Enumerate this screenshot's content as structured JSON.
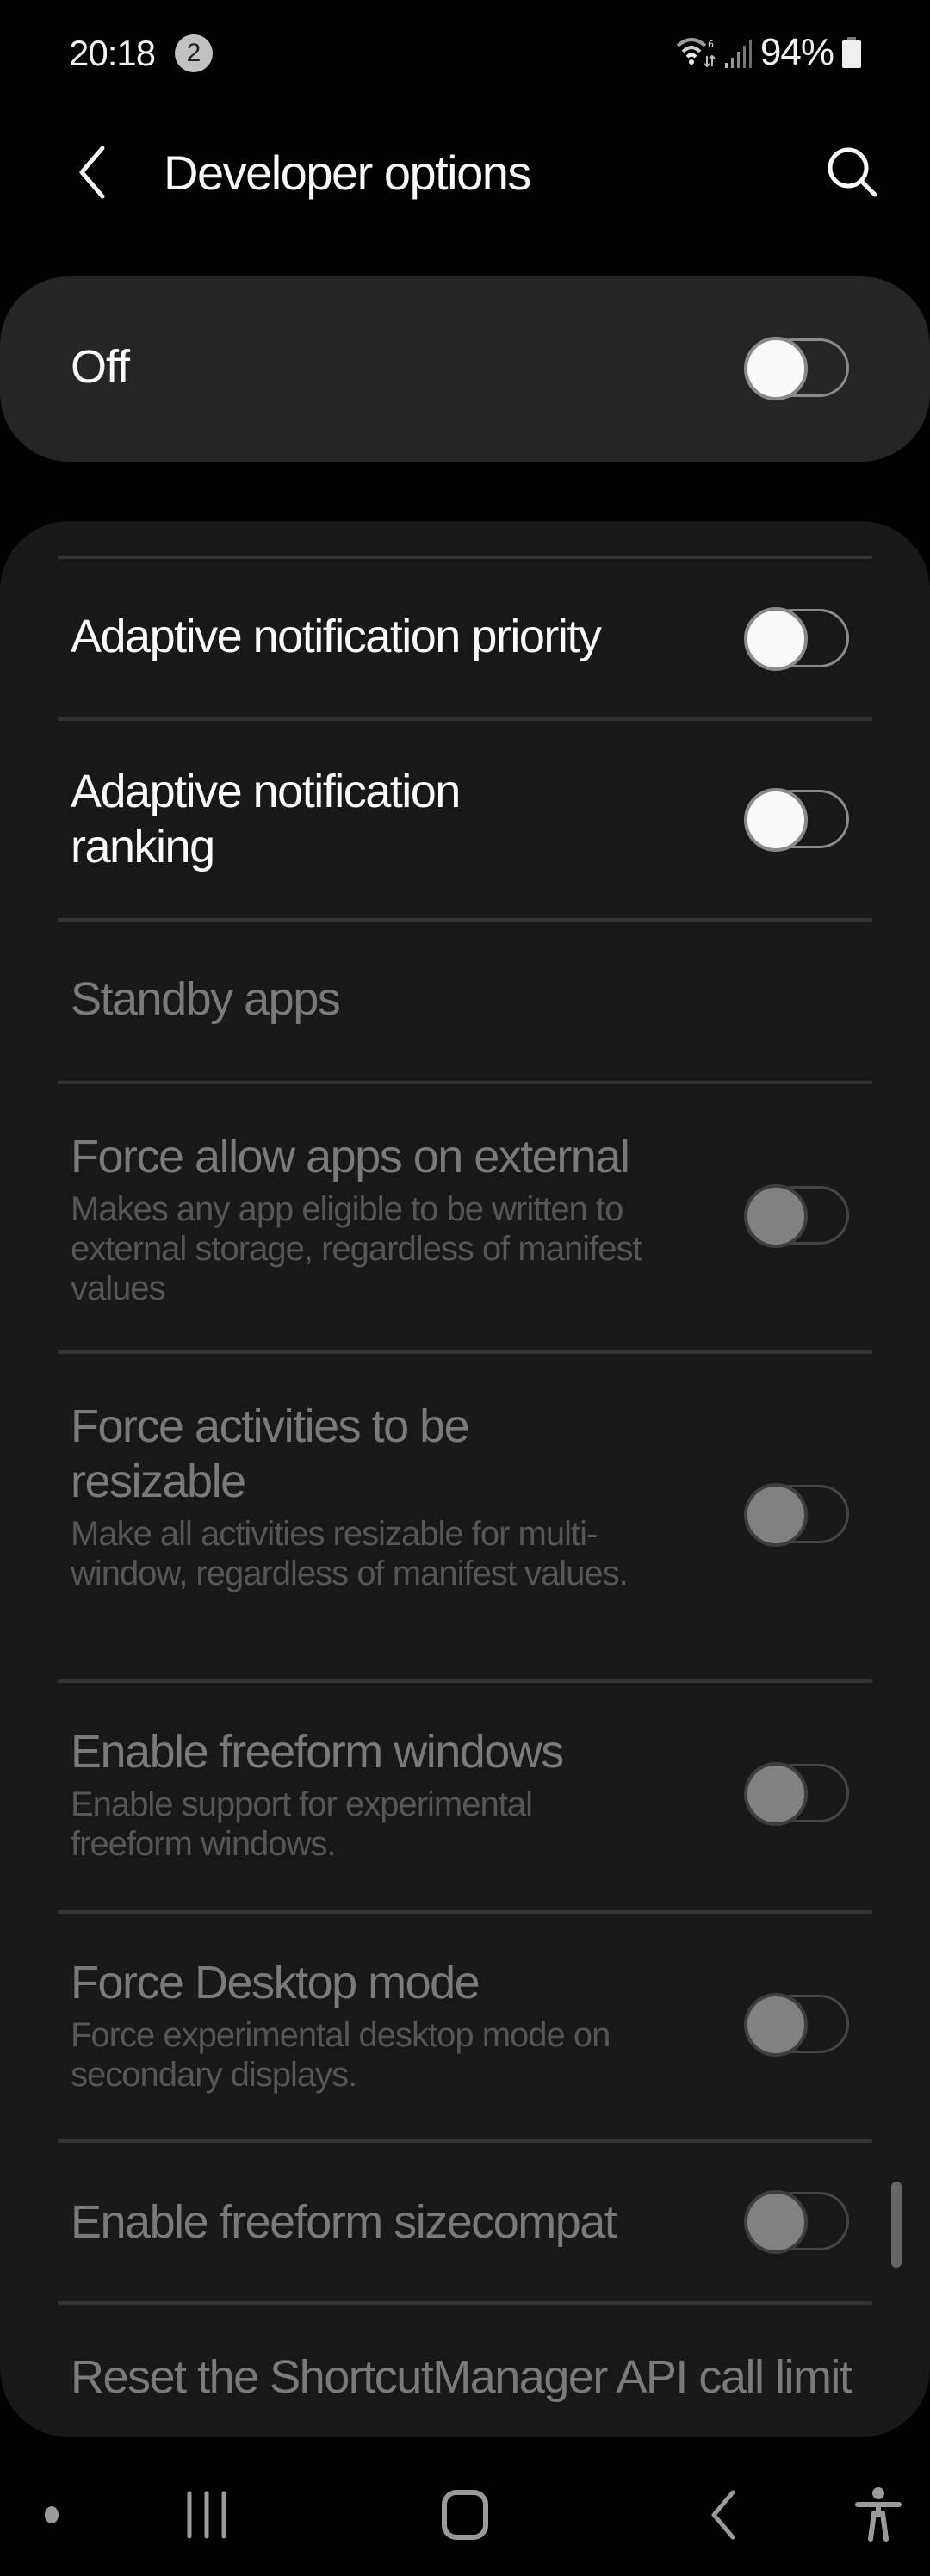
{
  "status_bar": {
    "time": "20:18",
    "notification_count": "2",
    "wifi_icon": "wifi-6-icon",
    "signal_icon": "signal-icon",
    "battery_percent": "94%",
    "battery_icon": "battery-icon"
  },
  "header": {
    "back_icon": "back-arrow-icon",
    "title": "Developer options",
    "search_icon": "search-icon"
  },
  "master_switch": {
    "label": "Off",
    "checked": false
  },
  "settings": [
    {
      "title": "Adaptive notification priority",
      "subtitle": "",
      "toggle": true,
      "checked": false,
      "enabled": true
    },
    {
      "title": "Adaptive notification ranking",
      "subtitle": "",
      "toggle": true,
      "checked": false,
      "enabled": true
    },
    {
      "title": "Standby apps",
      "subtitle": "",
      "toggle": false,
      "enabled": false
    },
    {
      "title": "Force allow apps on external",
      "subtitle": "Makes any app eligible to be written to external storage, regardless of manifest values",
      "toggle": true,
      "checked": false,
      "enabled": false
    },
    {
      "title": "Force activities to be resizable",
      "subtitle": "Make all activities resizable for multi-window, regardless of manifest values.",
      "toggle": true,
      "checked": false,
      "enabled": false
    },
    {
      "title": "Enable freeform windows",
      "subtitle": "Enable support for experimental freeform windows.",
      "toggle": true,
      "checked": false,
      "enabled": false
    },
    {
      "title": "Force Desktop mode",
      "subtitle": "Force experimental desktop mode on secondary displays.",
      "toggle": true,
      "checked": false,
      "enabled": false
    },
    {
      "title": "Enable freeform sizecompat",
      "subtitle": "",
      "toggle": true,
      "checked": false,
      "enabled": false
    },
    {
      "title": "Reset the ShortcutManager API call limit",
      "subtitle": "",
      "toggle": false,
      "enabled": false
    }
  ],
  "nav_bar": {
    "dot_icon": "keyboard-dot-icon",
    "recents_icon": "recent-apps-icon",
    "home_icon": "home-icon",
    "back_icon": "back-icon",
    "accessibility_icon": "accessibility-icon"
  },
  "colors": {
    "background": "#000000",
    "master_card": "#252525",
    "list_card": "#181818",
    "divider": "#333333",
    "text_primary": "#fafafa",
    "text_disabled": "#7a7a7a",
    "subtitle_disabled": "#565656"
  }
}
